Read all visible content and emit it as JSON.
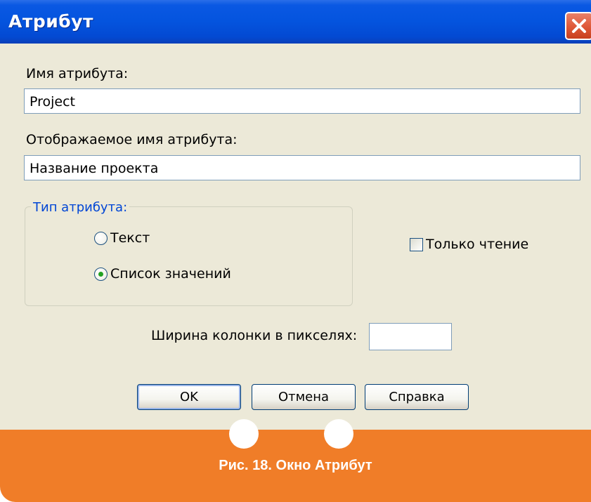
{
  "dialog": {
    "title": "Атрибут",
    "attribute_name_label": "Имя атрибута:",
    "attribute_name_value": "Project",
    "display_name_label": "Отображаемое имя атрибута:",
    "display_name_value": "Название проекта",
    "attribute_type": {
      "legend": "Тип атрибута:",
      "options": [
        {
          "label": "Текст",
          "selected": false
        },
        {
          "label": "Список значений",
          "selected": true
        }
      ]
    },
    "read_only": {
      "label": "Только чтение",
      "checked": false
    },
    "column_width_label": "Ширина колонки в пикселях:",
    "column_width_value": "",
    "buttons": {
      "ok": "OK",
      "cancel": "Отмена",
      "help": "Справка"
    }
  },
  "caption": "Рис. 18. Окно Атрибут",
  "colors": {
    "titlebar": "#0454de",
    "dialog_bg": "#ece9d8",
    "caption_band": "#f07d28",
    "group_legend": "#0046d5"
  }
}
